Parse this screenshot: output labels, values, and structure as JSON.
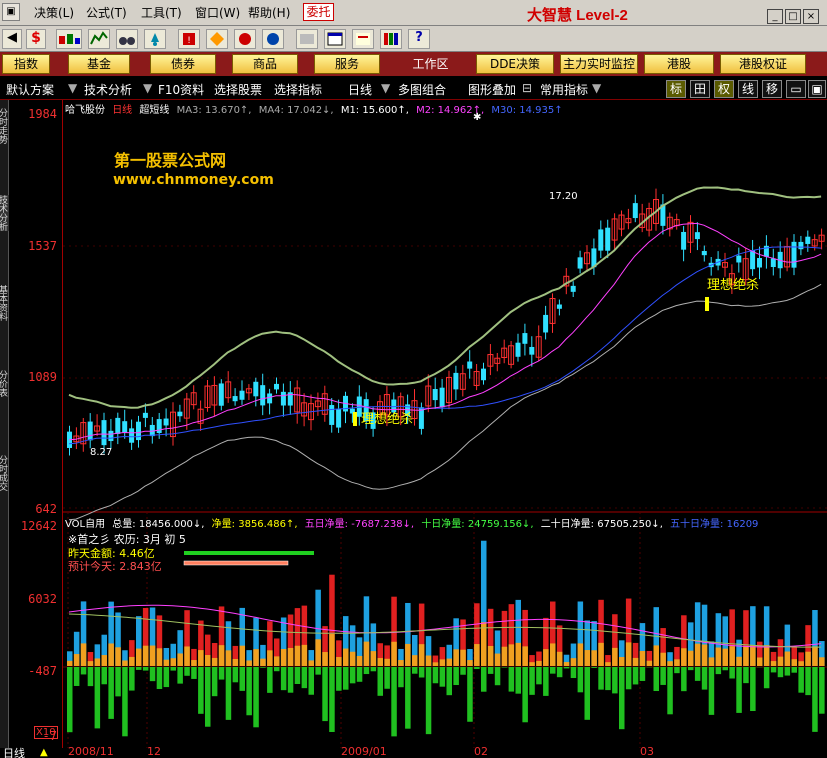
{
  "menubar": {
    "items": [
      "决策(L)",
      "公式(T)",
      "工具(T)",
      "窗口(W)",
      "帮助(H)"
    ],
    "order_button": "委托",
    "logo_text": "大智慧 Level-2"
  },
  "toolbar": {
    "icons": [
      "back-icon",
      "dollar-icon",
      "bar-chart-icon",
      "stocks-icon",
      "binoculars-icon",
      "alarm-icon",
      "stop-icon",
      "kline-icon",
      "monitor-icon",
      "globe-icon",
      "search-icon",
      "window-icon",
      "card-icon",
      "books-icon",
      "help-icon"
    ]
  },
  "navbar": {
    "buttons": [
      "指数",
      "基金",
      "债券",
      "商品",
      "服务",
      "DDE决策",
      "主力实时监控",
      "港股",
      "港股权证"
    ],
    "workzone": "工作区"
  },
  "funcbar": {
    "items": [
      "默认方案",
      "技术分析",
      "F10资料",
      "选择股票",
      "选择指标",
      "日线",
      "多图组合",
      "图形叠加",
      "常用指标"
    ],
    "toggles": [
      "标",
      "田",
      "权",
      "线",
      "移"
    ]
  },
  "sidebar": {
    "tabs": [
      "分时走势",
      "技术分析",
      "基本资料",
      "分价表",
      "分时成交"
    ]
  },
  "main": {
    "header": [
      {
        "text": "哈飞股份",
        "color": "#ffffff"
      },
      {
        "text": "日线",
        "color": "#ff3333"
      },
      {
        "text": "超短线",
        "color": "#ffffff"
      },
      {
        "text": "MA3: 13.670↑,",
        "color": "#aaaaaa"
      },
      {
        "text": "MA4: 17.042↓,",
        "color": "#aaaaaa"
      },
      {
        "text": "M1: 15.600↑,",
        "color": "#ffffff"
      },
      {
        "text": "M2: 14.962↑,",
        "color": "#ff44ff"
      },
      {
        "text": "M30: 14.935↑",
        "color": "#4466ff"
      }
    ],
    "yaxis": [
      "1984",
      "1537",
      "1089",
      "642"
    ],
    "watermark": {
      "title": "第一股票公式网",
      "url": "www.chnmoney.com"
    },
    "tags": {
      "high": "17.20",
      "low": "8.27",
      "signal1": "理想绝杀",
      "signal2": "理想绝杀"
    }
  },
  "sub": {
    "header": [
      {
        "text": "VOL自用",
        "color": "#ffffff"
      },
      {
        "text": "总量: 18456.000↓,",
        "color": "#ffffff"
      },
      {
        "text": "净量: 3856.486↑,",
        "color": "#ffff00"
      },
      {
        "text": "五日净量: -7687.238↓,",
        "color": "#ff44ff"
      },
      {
        "text": "十日净量: 24759.156↓,",
        "color": "#44ff44"
      },
      {
        "text": "二十日净量: 67505.250↓,",
        "color": "#ffffff"
      },
      {
        "text": "五十日净量: 16209",
        "color": "#4466ff"
      }
    ],
    "yaxis": [
      "12642",
      "6032",
      "-487",
      "-7"
    ],
    "lunar": "※首之彡   农历: 3月  初 5",
    "yesterday": "昨天金额: 4.46亿",
    "forecast": "预计今天: 2.843亿",
    "zoom": "X10"
  },
  "xaxis": {
    "labels": [
      "2008/11",
      "12",
      "2009/01",
      "02",
      "03"
    ],
    "period": "日线"
  },
  "chart_data": {
    "type": "candlestick",
    "ylim": [
      642,
      1984
    ],
    "tick_labels": [
      "1984",
      "1537",
      "1089",
      "642"
    ],
    "annotations": [
      "17.20",
      "8.27"
    ],
    "volume_ylim": [
      -487,
      12642
    ]
  }
}
